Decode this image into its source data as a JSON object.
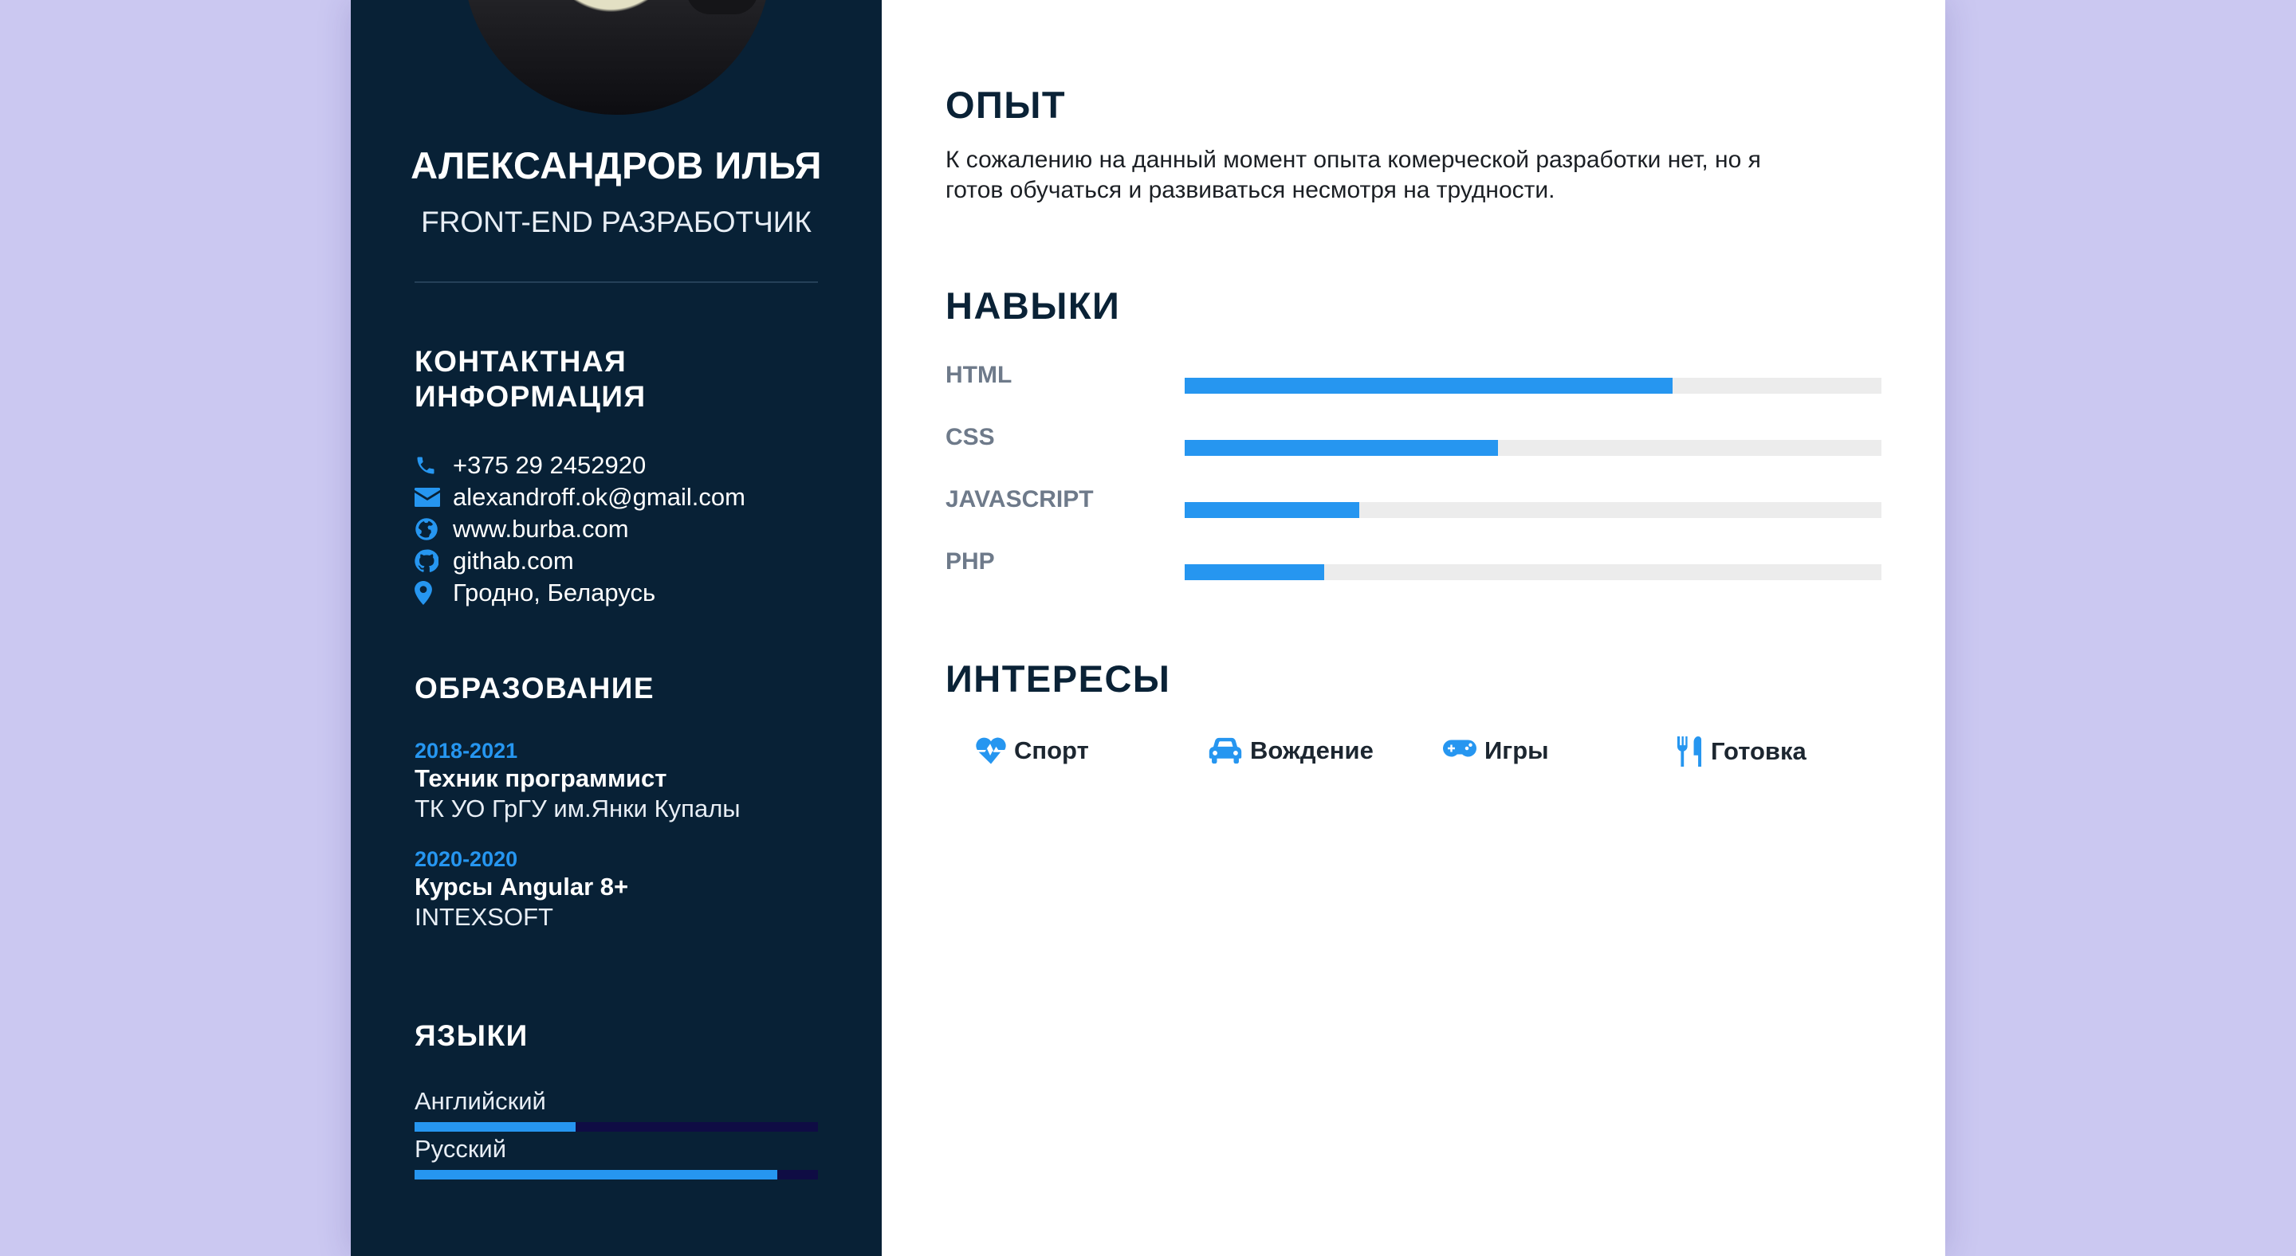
{
  "profile": {
    "name": "АЛЕКСАНДРОВ ИЛЬЯ",
    "role": "FRONT-END РАЗРАБОТЧИК"
  },
  "contact": {
    "heading_line1": "КОНТАКТНАЯ",
    "heading_line2": "ИНФОРМАЦИЯ",
    "items": [
      {
        "icon": "phone-icon",
        "text": "+375 29 2452920"
      },
      {
        "icon": "envelope-icon",
        "text": "alexandroff.ok@gmail.com"
      },
      {
        "icon": "globe-icon",
        "text": "www.burba.com"
      },
      {
        "icon": "github-icon",
        "text": "githab.com"
      },
      {
        "icon": "map-marker-icon",
        "text": "Гродно, Беларусь"
      }
    ]
  },
  "education": {
    "heading": "ОБРАЗОВАНИЕ",
    "items": [
      {
        "years": "2018-2021",
        "title": "Техник программист",
        "institution": "ТК УО ГрГУ им.Янки Купалы"
      },
      {
        "years": "2020-2020",
        "title": "Курсы Angular 8+",
        "institution": "INTEXSOFT"
      }
    ]
  },
  "languages": {
    "heading": "ЯЗЫКИ",
    "items": [
      {
        "name": "Английский",
        "level": 0.4
      },
      {
        "name": "Русский",
        "level": 0.9
      }
    ]
  },
  "experience": {
    "heading": "ОПЫТ",
    "text_line1": "К сожалению на данный момент опыта комерческой разработки нет, но я",
    "text_line2": "готов обучаться и развиваться несмотря на трудности."
  },
  "skills": {
    "heading": "НАВЫКИ",
    "items": [
      {
        "name": "HTML",
        "level": 0.7
      },
      {
        "name": "CSS",
        "level": 0.45
      },
      {
        "name": "JAVASCRIPT",
        "level": 0.25
      },
      {
        "name": "PHP",
        "level": 0.2
      }
    ]
  },
  "interests": {
    "heading": "ИНТЕРЕСЫ",
    "items": [
      {
        "icon": "heartbeat-icon",
        "label": "Спорт"
      },
      {
        "icon": "car-icon",
        "label": "Вождение"
      },
      {
        "icon": "gamepad-icon",
        "label": "Игры"
      },
      {
        "icon": "utensils-icon",
        "label": "Готовка"
      }
    ]
  },
  "colors": {
    "background": "#cbc8f1",
    "sidebar": "#082136",
    "accent": "#2696f0",
    "skill_track": "#ececec",
    "language_track": "#0f0c44"
  }
}
